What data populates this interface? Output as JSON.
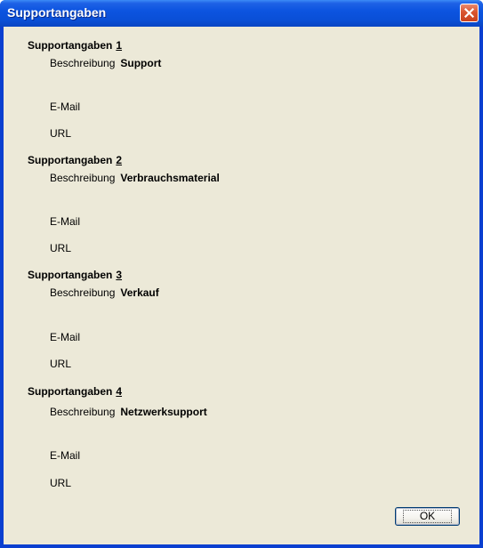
{
  "window": {
    "title": "Supportangaben",
    "close_icon": "close-icon",
    "title_color": "#0a4fd6",
    "client_color": "#ece9d8"
  },
  "sections": [
    {
      "header": "Supportangaben",
      "number": "1",
      "description_label": "Beschreibung",
      "description_value": "Support",
      "email_label": "E-Mail",
      "url_label": "URL"
    },
    {
      "header": "Supportangaben",
      "number": "2",
      "description_label": "Beschreibung",
      "description_value": "Verbrauchsmaterial",
      "email_label": "E-Mail",
      "url_label": "URL"
    },
    {
      "header": "Supportangaben",
      "number": "3",
      "description_label": "Beschreibung",
      "description_value": "Verkauf",
      "email_label": "E-Mail",
      "url_label": "URL"
    },
    {
      "header": "Supportangaben",
      "number": "4",
      "description_label": "Beschreibung",
      "description_value": "Netzwerksupport",
      "email_label": "E-Mail",
      "url_label": "URL"
    }
  ],
  "buttons": {
    "ok_label": "OK"
  }
}
